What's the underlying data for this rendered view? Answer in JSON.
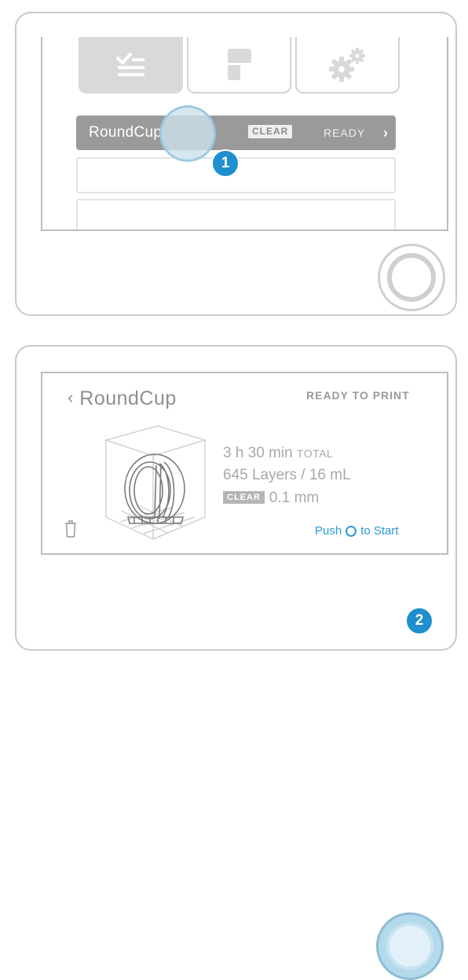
{
  "panel1": {
    "tabs": [
      {
        "icon": "job-list-icon"
      },
      {
        "icon": "resin-tank-icon"
      },
      {
        "icon": "settings-gears-icon"
      }
    ],
    "selected_job": {
      "name": "RoundCup",
      "badge": "CLEAR",
      "status": "READY",
      "chevron": "›"
    },
    "touch_step": "1"
  },
  "panel2": {
    "back_glyph": "‹",
    "title": "RoundCup",
    "status": "READY TO PRINT",
    "time": "3 h 30 min",
    "time_suffix": "TOTAL",
    "layers": "645 Layers / 16 mL",
    "material": "CLEAR",
    "resolution": "0.1 mm",
    "push_prefix": "Push",
    "push_suffix": "to Start",
    "touch_step": "2"
  },
  "colors": {
    "accent": "#1f8fcd",
    "link": "#2b9bd6",
    "row_selected": "#9a9a9a"
  }
}
